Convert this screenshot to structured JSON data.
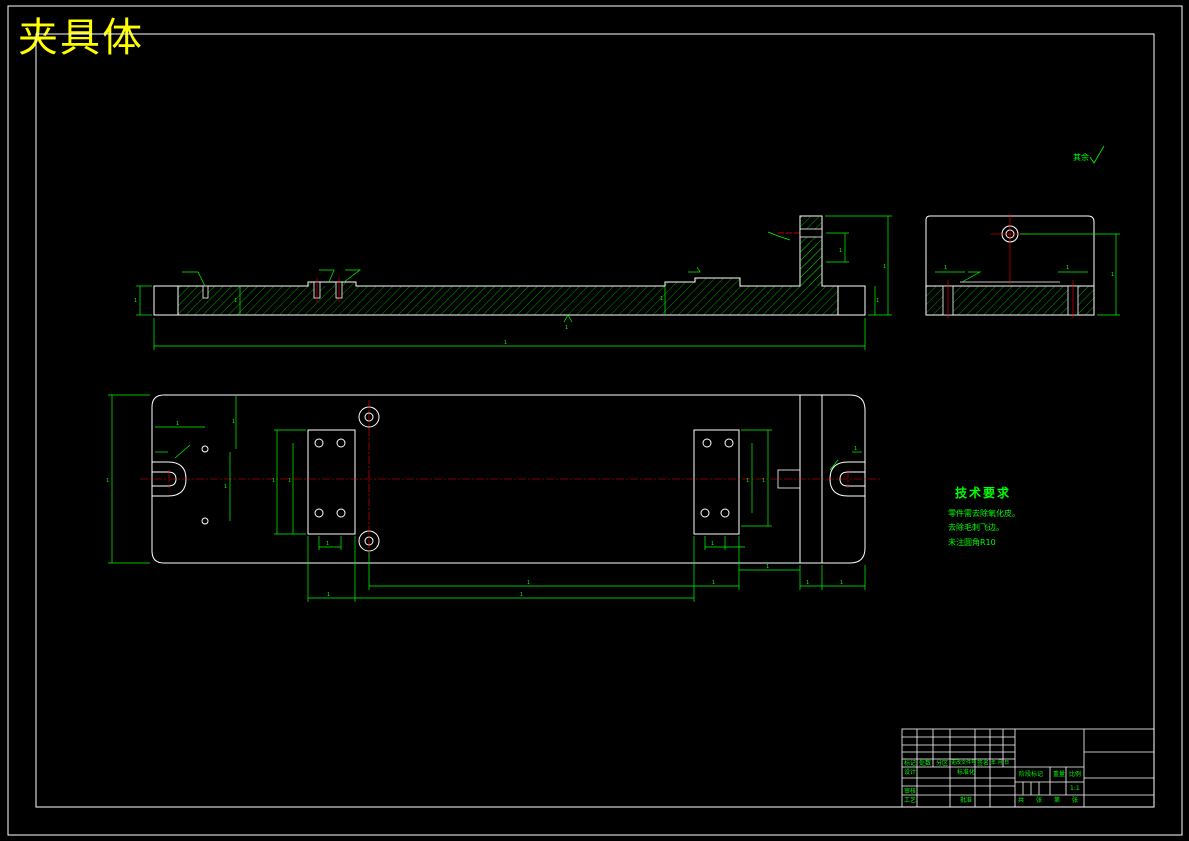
{
  "drawing": {
    "title": "夹具体",
    "roughness_note": "其余",
    "technical_requirements": {
      "heading": "技术要求",
      "lines": [
        "零件需去除氧化皮。",
        "去除毛刺飞边。",
        "未注圆角R10"
      ]
    },
    "colors": {
      "background": "#000000",
      "border": "#ffffff",
      "outline": "#ffffff",
      "dimension": "#00ff00",
      "centerline": "#ff0000",
      "title": "#ffff00"
    },
    "title_block": {
      "labels": [
        "标记",
        "处数",
        "分区",
        "更改文件号",
        "签名",
        "年.月.日",
        "设计",
        "标准化",
        "审核",
        "工艺",
        "批准",
        "阶段标记",
        "重量",
        "比例",
        "共",
        "张",
        "第",
        "张"
      ],
      "scale": "1:1"
    }
  }
}
